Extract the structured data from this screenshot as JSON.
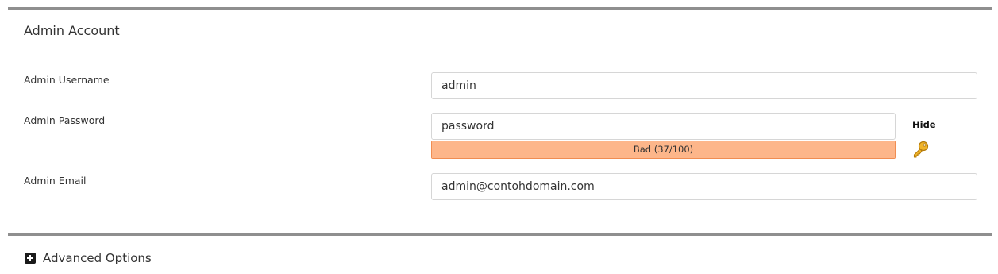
{
  "section": {
    "title": "Admin Account"
  },
  "fields": {
    "username": {
      "label": "Admin Username",
      "value": "admin"
    },
    "password": {
      "label": "Admin Password",
      "value": "password",
      "strength_text": "Bad (37/100)",
      "strength_score": 37,
      "strength_max": 100,
      "strength_color": "#fdb68a",
      "toggle_label": "Hide",
      "generate_icon": "key-icon"
    },
    "email": {
      "label": "Admin Email",
      "value": "admin@contohdomain.com"
    }
  },
  "advanced": {
    "label": "Advanced Options",
    "icon": "plus-square-icon"
  }
}
